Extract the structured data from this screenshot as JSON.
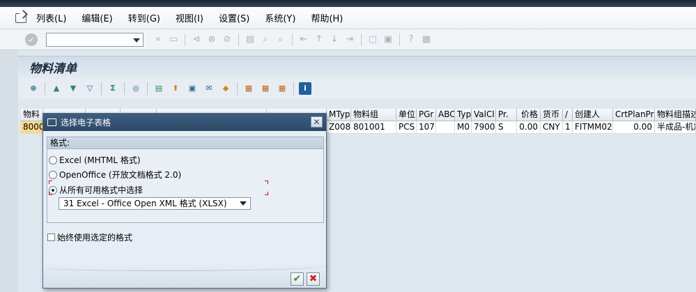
{
  "menu": {
    "items": [
      "列表(L)",
      "编辑(E)",
      "转到(G)",
      "视图(I)",
      "设置(S)",
      "系统(Y)",
      "帮助(H)"
    ]
  },
  "toolbar": {
    "command_value": ""
  },
  "page": {
    "title": "物料清单"
  },
  "grid": {
    "left_headers": [
      "物料"
    ],
    "left_value": "8000",
    "headers": [
      "MTyp",
      "物料组",
      "单位",
      "PGr",
      "ABC",
      "Typ",
      "ValCl",
      "Pr.",
      "价格",
      "货币",
      "/",
      "创建人",
      "CrtPlanPrc",
      "物料组描述"
    ],
    "row": [
      "Z008",
      "801001",
      "PCS",
      "107",
      "",
      "M0",
      "7900",
      "S",
      "0.00",
      "CNY",
      "1",
      "FITMM02",
      "0.00",
      "半成品-机加"
    ]
  },
  "dialog": {
    "title": "选择电子表格",
    "group_label": "格式:",
    "options": [
      "Excel (MHTML 格式)",
      "OpenOffice (开放文档格式 2.0)",
      "从所有可用格式中选择"
    ],
    "selected_option": 2,
    "format_select": "31 Excel - Office Open XML 格式 (XLSX)",
    "checkbox_label": "始终使用选定的格式",
    "checkbox_checked": false
  },
  "colors": {
    "title_bar": "#2c4866",
    "highlight": "#fbd98a",
    "focus": "#d01010"
  }
}
